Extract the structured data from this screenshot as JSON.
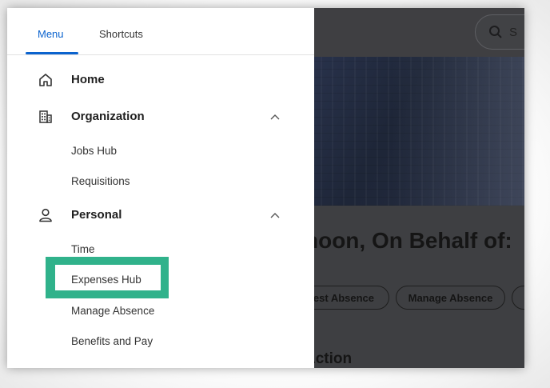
{
  "tabs": {
    "menu": "Menu",
    "shortcuts": "Shortcuts"
  },
  "search": {
    "partial_text": "S",
    "icon": "search-icon"
  },
  "nav": {
    "home": {
      "label": "Home",
      "icon": "home-icon"
    },
    "organization": {
      "label": "Organization",
      "icon": "building-icon",
      "expanded": true,
      "items": [
        "Jobs Hub",
        "Requisitions"
      ]
    },
    "personal": {
      "label": "Personal",
      "icon": "person-icon",
      "expanded": true,
      "items": [
        "Time",
        "Expenses Hub",
        "Manage Absence",
        "Benefits and Pay"
      ]
    }
  },
  "highlighted_item": "Expenses Hub",
  "background": {
    "greeting": "noon, On Behalf of:",
    "chips": [
      "uest Absence",
      "Manage Absence"
    ],
    "section_title": "Action"
  },
  "colors": {
    "accent": "#0b63ce",
    "highlight": "#30b28b"
  }
}
